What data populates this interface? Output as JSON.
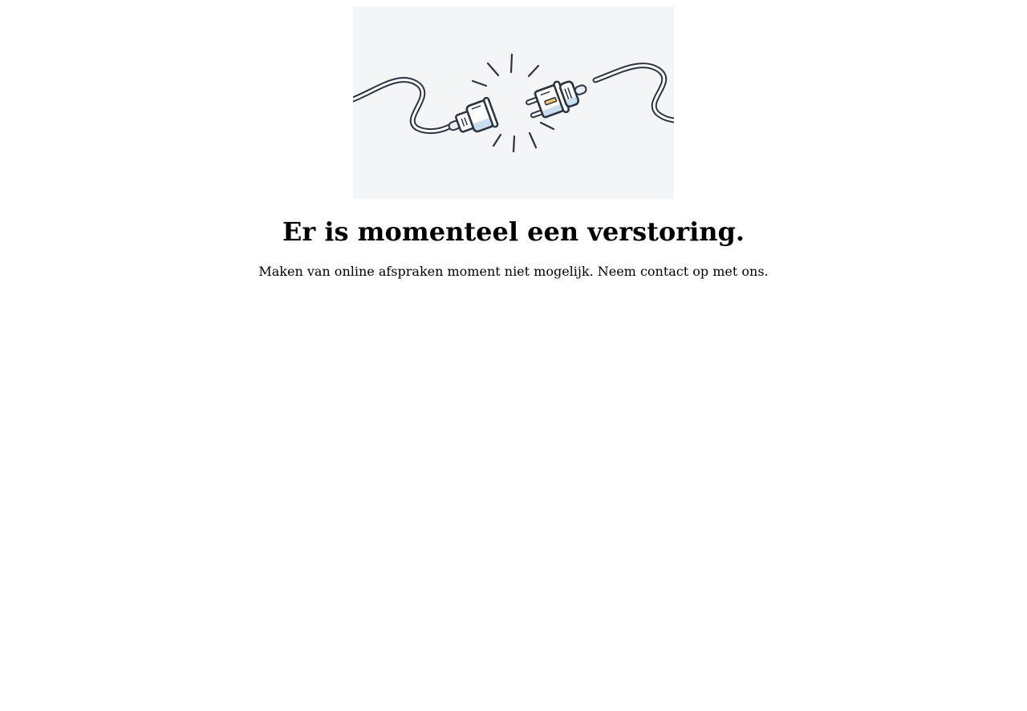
{
  "illustration": {
    "icon": "unplugged-cable-icon",
    "colors": {
      "background": "#f4f5f7",
      "stroke": "#2b3440",
      "plug_fill": "#ffffff",
      "highlight_blue": "#c9dff0",
      "highlight_yellow": "#f5c66a"
    }
  },
  "error": {
    "title": "Er is momenteel een verstoring.",
    "message": "Maken van online afspraken moment niet mogelijk. Neem contact op met ons."
  }
}
